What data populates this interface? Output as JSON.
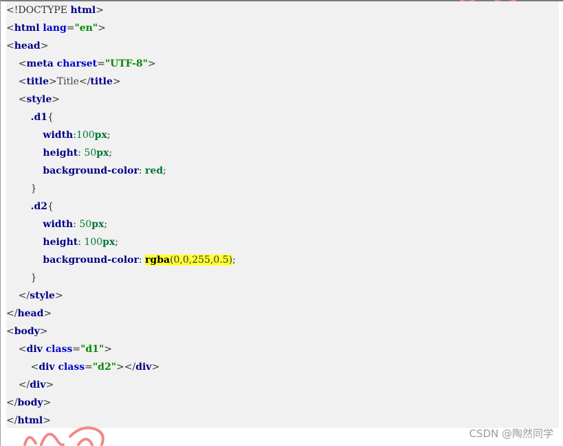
{
  "code": {
    "lines": [
      {
        "tokens": [
          {
            "c": "doctype",
            "t": "<!DOCTYPE "
          },
          {
            "c": "tag",
            "t": "html"
          },
          {
            "c": "punct",
            "t": ">"
          }
        ]
      },
      {
        "tokens": [
          {
            "c": "punct",
            "t": "<"
          },
          {
            "c": "tag",
            "t": "html"
          },
          {
            "c": "attr",
            "t": " lang"
          },
          {
            "c": "punct",
            "t": "="
          },
          {
            "c": "str",
            "t": "\"en\""
          },
          {
            "c": "punct",
            "t": ">"
          }
        ]
      },
      {
        "tokens": [
          {
            "c": "punct",
            "t": "<"
          },
          {
            "c": "tag",
            "t": "head"
          },
          {
            "c": "punct",
            "t": ">"
          }
        ]
      },
      {
        "tokens": [
          {
            "c": "punct",
            "t": "    <"
          },
          {
            "c": "tag",
            "t": "meta"
          },
          {
            "c": "attr",
            "t": " charset"
          },
          {
            "c": "punct",
            "t": "="
          },
          {
            "c": "str",
            "t": "\"UTF-8\""
          },
          {
            "c": "punct",
            "t": ">"
          }
        ]
      },
      {
        "tokens": [
          {
            "c": "punct",
            "t": "    <"
          },
          {
            "c": "tag",
            "t": "title"
          },
          {
            "c": "punct",
            "t": ">"
          },
          {
            "c": "text",
            "t": "Title"
          },
          {
            "c": "punct",
            "t": "</"
          },
          {
            "c": "tag",
            "t": "title"
          },
          {
            "c": "punct",
            "t": ">"
          }
        ]
      },
      {
        "tokens": [
          {
            "c": "punct",
            "t": "    <"
          },
          {
            "c": "tag",
            "t": "style"
          },
          {
            "c": "punct",
            "t": ">"
          }
        ]
      },
      {
        "tokens": [
          {
            "c": "punct",
            "t": "        "
          },
          {
            "c": "sel",
            "t": ".d1"
          },
          {
            "c": "punct",
            "t": "{"
          }
        ]
      },
      {
        "tokens": [
          {
            "c": "punct",
            "t": "            "
          },
          {
            "c": "prop",
            "t": "width"
          },
          {
            "c": "punct",
            "t": ":"
          },
          {
            "c": "num",
            "t": "100"
          },
          {
            "c": "unit",
            "t": "px"
          },
          {
            "c": "punct",
            "t": ";"
          }
        ]
      },
      {
        "tokens": [
          {
            "c": "punct",
            "t": "            "
          },
          {
            "c": "prop",
            "t": "height"
          },
          {
            "c": "punct",
            "t": ": "
          },
          {
            "c": "num",
            "t": "50"
          },
          {
            "c": "unit",
            "t": "px"
          },
          {
            "c": "punct",
            "t": ";"
          }
        ]
      },
      {
        "tokens": [
          {
            "c": "punct",
            "t": "            "
          },
          {
            "c": "prop",
            "t": "background-color"
          },
          {
            "c": "punct",
            "t": ": "
          },
          {
            "c": "val",
            "t": "red"
          },
          {
            "c": "punct",
            "t": ";"
          }
        ]
      },
      {
        "tokens": [
          {
            "c": "punct",
            "t": "        }"
          }
        ]
      },
      {
        "tokens": [
          {
            "c": "punct",
            "t": "        "
          },
          {
            "c": "sel",
            "t": ".d2"
          },
          {
            "c": "punct",
            "t": "{"
          }
        ]
      },
      {
        "tokens": [
          {
            "c": "punct",
            "t": "            "
          },
          {
            "c": "prop",
            "t": "width"
          },
          {
            "c": "punct",
            "t": ": "
          },
          {
            "c": "num",
            "t": "50"
          },
          {
            "c": "unit",
            "t": "px"
          },
          {
            "c": "punct",
            "t": ";"
          }
        ]
      },
      {
        "tokens": [
          {
            "c": "punct",
            "t": "            "
          },
          {
            "c": "prop",
            "t": "height"
          },
          {
            "c": "punct",
            "t": ": "
          },
          {
            "c": "num",
            "t": "100"
          },
          {
            "c": "unit",
            "t": "px"
          },
          {
            "c": "punct",
            "t": ";"
          }
        ]
      },
      {
        "tokens": [
          {
            "c": "punct",
            "t": "            "
          },
          {
            "c": "prop",
            "t": "background-color"
          },
          {
            "c": "punct",
            "t": ": "
          },
          {
            "c": "func",
            "t": "rgba",
            "hl": true
          },
          {
            "c": "punct",
            "t": "(0,0,255,0.5)",
            "hl": true
          },
          {
            "c": "punct",
            "t": ";"
          }
        ]
      },
      {
        "tokens": [
          {
            "c": "punct",
            "t": "        }"
          }
        ]
      },
      {
        "tokens": [
          {
            "c": "punct",
            "t": "    </"
          },
          {
            "c": "tag",
            "t": "style"
          },
          {
            "c": "punct",
            "t": ">"
          }
        ]
      },
      {
        "tokens": [
          {
            "c": "punct",
            "t": "</"
          },
          {
            "c": "tag",
            "t": "head"
          },
          {
            "c": "punct",
            "t": ">"
          }
        ]
      },
      {
        "tokens": [
          {
            "c": "punct",
            "t": "<"
          },
          {
            "c": "tag",
            "t": "body"
          },
          {
            "c": "punct",
            "t": ">"
          }
        ]
      },
      {
        "tokens": [
          {
            "c": "punct",
            "t": "    <"
          },
          {
            "c": "tag",
            "t": "div"
          },
          {
            "c": "attr",
            "t": " class"
          },
          {
            "c": "punct",
            "t": "="
          },
          {
            "c": "str",
            "t": "\"d1\""
          },
          {
            "c": "punct",
            "t": ">"
          }
        ]
      },
      {
        "tokens": [
          {
            "c": "punct",
            "t": "        <"
          },
          {
            "c": "tag",
            "t": "div"
          },
          {
            "c": "attr",
            "t": " class"
          },
          {
            "c": "punct",
            "t": "="
          },
          {
            "c": "str",
            "t": "\"d2\""
          },
          {
            "c": "punct",
            "t": "></"
          },
          {
            "c": "tag",
            "t": "div"
          },
          {
            "c": "punct",
            "t": ">"
          }
        ]
      },
      {
        "tokens": [
          {
            "c": "punct",
            "t": "    </"
          },
          {
            "c": "tag",
            "t": "div"
          },
          {
            "c": "punct",
            "t": ">"
          }
        ]
      },
      {
        "tokens": [
          {
            "c": "punct",
            "t": "</"
          },
          {
            "c": "tag",
            "t": "body"
          },
          {
            "c": "punct",
            "t": ">"
          }
        ]
      },
      {
        "tokens": [
          {
            "c": "punct",
            "t": "</"
          },
          {
            "c": "tag",
            "t": "html"
          },
          {
            "c": "punct",
            "t": ">"
          }
        ]
      }
    ]
  },
  "watermark": {
    "text": "CSDN @陶然同学"
  },
  "colors": {
    "panel_bg": "#f1f1f1",
    "tag": "#000088",
    "string": "#008800",
    "highlight": "#ffff33",
    "decoration": "#f08a8a"
  },
  "icons": {
    "decoration": "red-swirl-decoration"
  }
}
